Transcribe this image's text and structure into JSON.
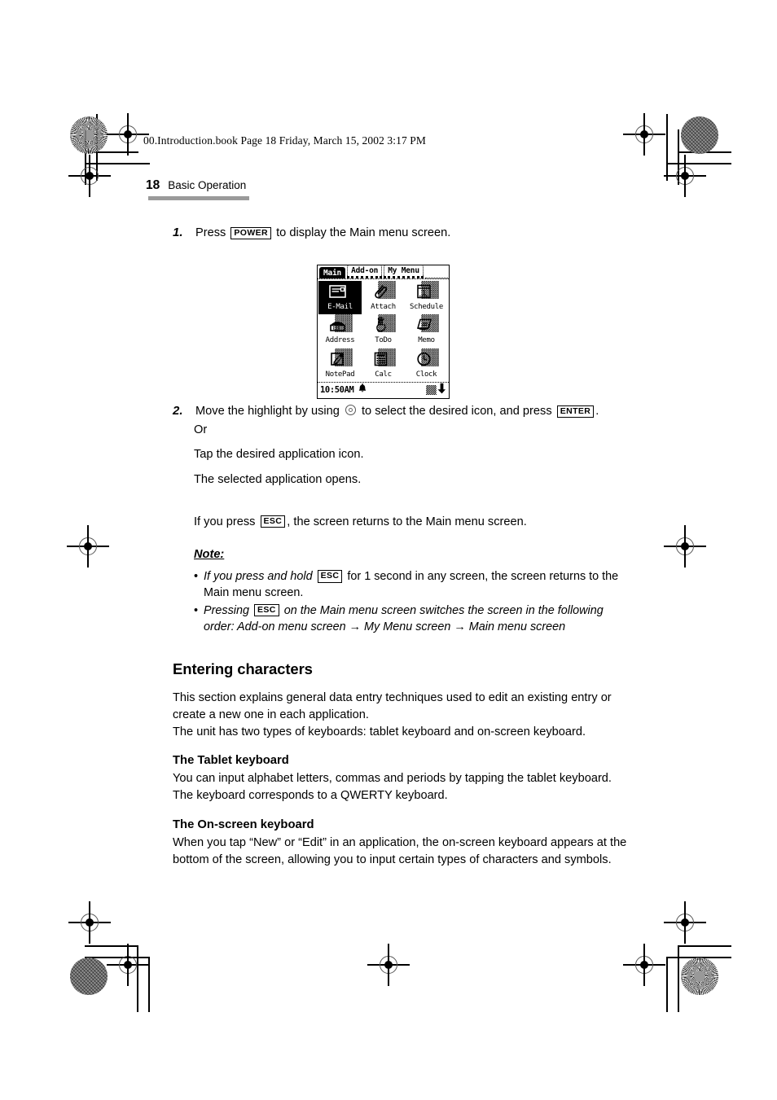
{
  "header": {
    "filestamp": "00.Introduction.book  Page 18  Friday, March 15, 2002  3:17 PM",
    "page_number": "18",
    "section": "Basic Operation"
  },
  "steps": [
    {
      "num": "1.",
      "pre": "Press",
      "key": "POWER",
      "post": "to display the Main menu screen."
    },
    {
      "num": "2.",
      "pre": "Move the highlight by using",
      "icon": "dpad-icon",
      "mid": "to select the desired icon, and press",
      "key": "ENTER",
      "post": "."
    }
  ],
  "after_step2": {
    "or": "Or",
    "tap": "Tap the desired application icon.",
    "opens": "The selected application opens.",
    "esc_pre": "If you press",
    "esc_key": "ESC",
    "esc_post": ", the screen returns to the Main menu screen."
  },
  "note": {
    "title": "Note:",
    "bullets": [
      {
        "marker": "•",
        "a": "If you press and hold",
        "key": "ESC",
        "b": "for 1 second in any screen, the screen returns to the Main menu screen."
      },
      {
        "marker": "•",
        "a": "Pressing",
        "key": "ESC",
        "b": "on the Main menu screen switches the screen in the following order: Add-on menu screen → My Menu screen → Main menu screen"
      }
    ]
  },
  "sections": {
    "entering_characters": {
      "heading": "Entering characters",
      "para1": "This section explains general data entry techniques used to edit an existing entry or create a new one in each application.",
      "para2": "The unit has two types of keyboards: tablet keyboard and on-screen keyboard."
    },
    "tablet_keyboard": {
      "heading": "The Tablet keyboard",
      "para": "You can input alphabet letters, commas and periods by tapping the tablet keyboard. The keyboard corresponds to a QWERTY keyboard."
    },
    "onscreen_keyboard": {
      "heading": "The On-screen keyboard",
      "para": "When you tap “New” or “Edit” in an application, the on-screen keyboard appears at the bottom of the screen, allowing you to input certain types of characters and symbols."
    }
  },
  "pda_screen": {
    "tabs": [
      {
        "label": "Main",
        "active": true
      },
      {
        "label": "Add-on",
        "active": false
      },
      {
        "label": "My Menu",
        "active": false
      }
    ],
    "icons": [
      {
        "label": "E-Mail",
        "icon": "envelope-icon",
        "selected": true
      },
      {
        "label": "Attach",
        "icon": "paperclip-icon",
        "selected": false
      },
      {
        "label": "Schedule",
        "icon": "calendar-icon",
        "selected": false
      },
      {
        "label": "Address",
        "icon": "telephone-icon",
        "selected": false
      },
      {
        "label": "ToDo",
        "icon": "hand-string-icon",
        "selected": false
      },
      {
        "label": "Memo",
        "icon": "memo-pad-icon",
        "selected": false
      },
      {
        "label": "NotePad",
        "icon": "notepad-pen-icon",
        "selected": false
      },
      {
        "label": "Calc",
        "icon": "calculator-icon",
        "selected": false
      },
      {
        "label": "Clock",
        "icon": "clock-icon",
        "selected": false
      }
    ],
    "statusbar": {
      "time": "10:50AM",
      "left_icon": "bell-icon",
      "right_icons": [
        "dither-block-icon",
        "down-arrow-icon"
      ]
    }
  }
}
